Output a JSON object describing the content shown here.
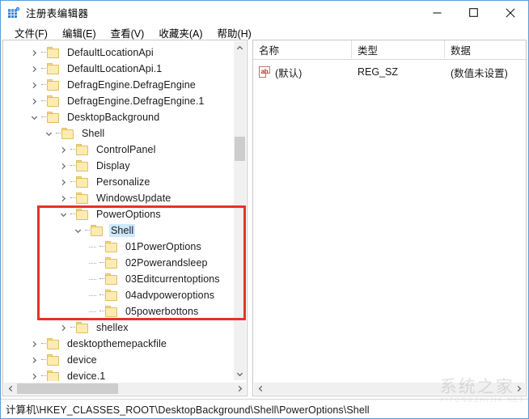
{
  "window": {
    "title": "注册表编辑器",
    "icon": "registry-editor-icon",
    "controls": {
      "minimize": "—",
      "maximize": "□",
      "close": "✕"
    }
  },
  "menubar": {
    "items": [
      {
        "label": "文件(F)",
        "name": "menu-file"
      },
      {
        "label": "编辑(E)",
        "name": "menu-edit"
      },
      {
        "label": "查看(V)",
        "name": "menu-view"
      },
      {
        "label": "收藏夹(A)",
        "name": "menu-favorites"
      },
      {
        "label": "帮助(H)",
        "name": "menu-help"
      }
    ]
  },
  "tree": {
    "rows": [
      {
        "label": "DefaultLocationApi",
        "depth": 1,
        "twist": "collapsed",
        "selected": false,
        "partial": false
      },
      {
        "label": "DefaultLocationApi.1",
        "depth": 1,
        "twist": "collapsed",
        "selected": false,
        "partial": false
      },
      {
        "label": "DefragEngine.DefragEngine",
        "depth": 1,
        "twist": "collapsed",
        "selected": false,
        "partial": false
      },
      {
        "label": "DefragEngine.DefragEngine.1",
        "depth": 1,
        "twist": "collapsed",
        "selected": false,
        "partial": false
      },
      {
        "label": "DesktopBackground",
        "depth": 1,
        "twist": "expanded",
        "selected": false,
        "partial": false
      },
      {
        "label": "Shell",
        "depth": 2,
        "twist": "expanded",
        "selected": false,
        "partial": false
      },
      {
        "label": "ControlPanel",
        "depth": 3,
        "twist": "collapsed",
        "selected": false,
        "partial": false
      },
      {
        "label": "Display",
        "depth": 3,
        "twist": "collapsed",
        "selected": false,
        "partial": false
      },
      {
        "label": "Personalize",
        "depth": 3,
        "twist": "collapsed",
        "selected": false,
        "partial": false
      },
      {
        "label": "WindowsUpdate",
        "depth": 3,
        "twist": "collapsed",
        "selected": false,
        "partial": false
      },
      {
        "label": "PowerOptions",
        "depth": 3,
        "twist": "expanded",
        "selected": false,
        "partial": false
      },
      {
        "label": "Shell",
        "depth": 4,
        "twist": "expanded",
        "selected": true,
        "partial": false
      },
      {
        "label": "01PowerOptions",
        "depth": 5,
        "twist": "none",
        "selected": false,
        "partial": false
      },
      {
        "label": "02Powerandsleep",
        "depth": 5,
        "twist": "none",
        "selected": false,
        "partial": false
      },
      {
        "label": "03Editcurrentoptions",
        "depth": 5,
        "twist": "none",
        "selected": false,
        "partial": false
      },
      {
        "label": "04advpoweroptions",
        "depth": 5,
        "twist": "none",
        "selected": false,
        "partial": false
      },
      {
        "label": "05powerbottons",
        "depth": 5,
        "twist": "none",
        "selected": false,
        "partial": false
      },
      {
        "label": "shellex",
        "depth": 3,
        "twist": "collapsed",
        "selected": false,
        "partial": false
      },
      {
        "label": "desktopthemepackfile",
        "depth": 1,
        "twist": "collapsed",
        "selected": false,
        "partial": false
      },
      {
        "label": "device",
        "depth": 1,
        "twist": "collapsed",
        "selected": false,
        "partial": false
      },
      {
        "label": "device.1",
        "depth": 1,
        "twist": "collapsed",
        "selected": false,
        "partial": false
      },
      {
        "label": "",
        "depth": 1,
        "twist": "collapsed",
        "selected": false,
        "partial": true
      }
    ],
    "annotation": {
      "color": "#e8312a",
      "shape": "rectangle",
      "covers_from": "PowerOptions",
      "covers_to": "05powerbottons"
    }
  },
  "list": {
    "columns": [
      {
        "label": "名称",
        "name": "column-name"
      },
      {
        "label": "类型",
        "name": "column-type"
      },
      {
        "label": "数据",
        "name": "column-data"
      }
    ],
    "rows": [
      {
        "icon": "string-value-icon",
        "icon_text": "ab",
        "name": "(默认)",
        "type": "REG_SZ",
        "data": "(数值未设置)"
      }
    ]
  },
  "statusbar": {
    "path": "计算机\\HKEY_CLASSES_ROOT\\DesktopBackground\\Shell\\PowerOptions\\Shell"
  },
  "watermark": {
    "text": "系统之家",
    "subtext": "XITONGZHIJIA.NET"
  },
  "colors": {
    "accent": "#5b9bd5",
    "annotation": "#e8312a",
    "selection": "#cde8ff",
    "folder": "#fcecb3",
    "folder_border": "#e3bd63"
  }
}
